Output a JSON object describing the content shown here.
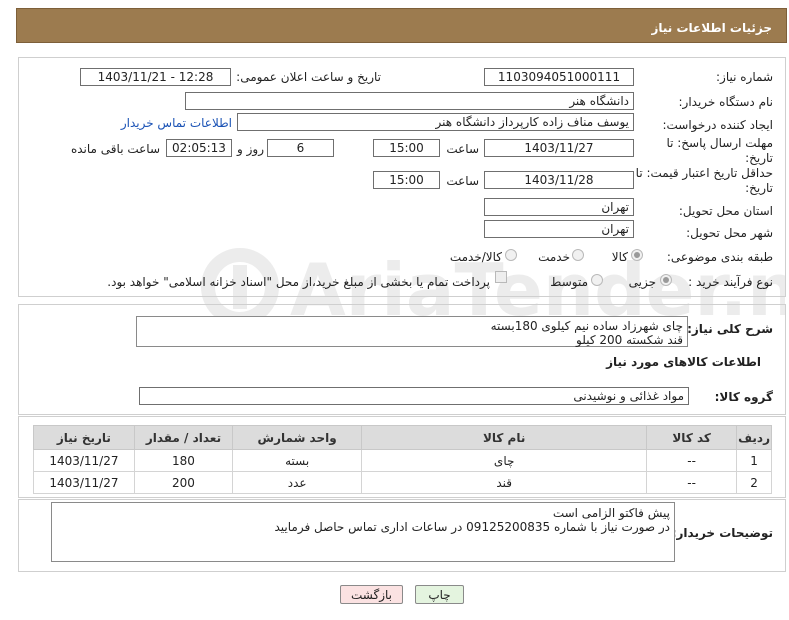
{
  "header": {
    "title": "جزئیات اطلاعات نیاز"
  },
  "form": {
    "need_number_label": "شماره نیاز:",
    "need_number": "1103094051000111",
    "announce_label": "تاریخ و ساعت اعلان عمومی:",
    "announce_value": "1403/11/21 - 12:28",
    "buyer_org_label": "نام دستگاه خریدار:",
    "buyer_org": "دانشگاه هنر",
    "creator_label": "ایجاد کننده درخواست:",
    "creator": "یوسف مناف زاده کارپرداز دانشگاه هنر",
    "contact_link": "اطلاعات تماس خریدار",
    "deadline_label_1": "مهلت ارسال پاسخ: تا",
    "deadline_label_2": "تاریخ:",
    "deadline_date": "1403/11/27",
    "time_label": "ساعت",
    "deadline_time": "15:00",
    "days_value": "6",
    "days_label": "روز و",
    "remaining_time": "02:05:13",
    "remaining_label": "ساعت باقی مانده",
    "validity_label_1": "حداقل تاریخ اعتبار قیمت: تا",
    "validity_label_2": "تاریخ:",
    "validity_date": "1403/11/28",
    "validity_time": "15:00",
    "province_label": "استان محل تحویل:",
    "province": "تهران",
    "city_label": "شهر محل تحویل:",
    "city": "تهران",
    "category_label": "طبقه بندی موضوعی:",
    "category_options": [
      "کالا",
      "خدمت",
      "کالا/خدمت"
    ],
    "purchase_type_label": "نوع فرآیند خرید :",
    "purchase_options": [
      "جزیی",
      "متوسط"
    ],
    "payment_note": "پرداخت تمام یا بخشی از مبلغ خرید،از محل \"اسناد خزانه اسلامی\" خواهد بود."
  },
  "description": {
    "label": "شرح کلی نیاز:",
    "line1": "چای شهرزاد ساده نیم کیلوی 180بسته",
    "line2": "قند شکسته 200 کیلو"
  },
  "goods_info": {
    "title": "اطلاعات کالاهای مورد نیاز",
    "group_label": "گروه کالا:",
    "group_value": "مواد غذائی و نوشیدنی"
  },
  "table": {
    "headers": [
      "ردیف",
      "کد کالا",
      "نام کالا",
      "واحد شمارش",
      "تعداد / مقدار",
      "تاریخ نیاز"
    ],
    "rows": [
      [
        "1",
        "--",
        "چای",
        "بسته",
        "180",
        "1403/11/27"
      ],
      [
        "2",
        "--",
        "قند",
        "عدد",
        "200",
        "1403/11/27"
      ]
    ]
  },
  "buyer_notes": {
    "label": "توضیحات خریدار:",
    "line1": "پیش فاکتو الزامی است",
    "line2": "در صورت نیاز با شماره 09125200835 در ساعات اداری تماس حاصل فرمایید"
  },
  "buttons": {
    "print": "چاپ",
    "back": "بازگشت"
  },
  "colors": {
    "header_bg": "#9c7b4f",
    "link": "#1a52b5",
    "back_button_bg": "#fbe2e2",
    "print_button_bg": "#e4f4df"
  }
}
